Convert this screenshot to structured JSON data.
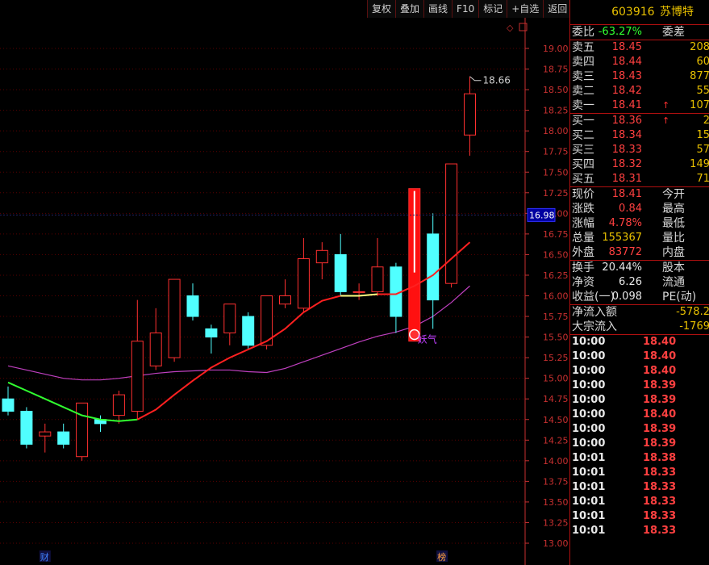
{
  "toolbar": {
    "buttons": [
      "复权",
      "叠加",
      "画线",
      "F10",
      "标记",
      "+自选",
      "返回"
    ]
  },
  "stock": {
    "code": "603916",
    "name": "苏博特"
  },
  "weibi": {
    "label": "委比",
    "value": "-63.27%",
    "label2": "委差"
  },
  "asks": [
    {
      "label": "卖五",
      "price": "18.45",
      "vol": "208",
      "arrow": ""
    },
    {
      "label": "卖四",
      "price": "18.44",
      "vol": "60",
      "arrow": ""
    },
    {
      "label": "卖三",
      "price": "18.43",
      "vol": "877",
      "arrow": ""
    },
    {
      "label": "卖二",
      "price": "18.42",
      "vol": "55",
      "arrow": ""
    },
    {
      "label": "卖一",
      "price": "18.41",
      "vol": "107",
      "arrow": "↑"
    }
  ],
  "bids": [
    {
      "label": "买一",
      "price": "18.36",
      "vol": "2",
      "arrow": "↑"
    },
    {
      "label": "买二",
      "price": "18.34",
      "vol": "15",
      "arrow": ""
    },
    {
      "label": "买三",
      "price": "18.33",
      "vol": "57",
      "arrow": ""
    },
    {
      "label": "买四",
      "price": "18.32",
      "vol": "149",
      "arrow": ""
    },
    {
      "label": "买五",
      "price": "18.31",
      "vol": "71",
      "arrow": ""
    }
  ],
  "stats1": [
    {
      "label": "现价",
      "value": "18.41",
      "color": "red",
      "label2": "今开"
    },
    {
      "label": "涨跌",
      "value": "0.84",
      "color": "red",
      "label2": "最高"
    },
    {
      "label": "涨幅",
      "value": "4.78%",
      "color": "red",
      "label2": "最低"
    },
    {
      "label": "总量",
      "value": "155367",
      "color": "yellow",
      "label2": "量比"
    },
    {
      "label": "外盘",
      "value": "83772",
      "color": "red",
      "label2": "内盘"
    }
  ],
  "stats2": [
    {
      "label": "换手",
      "value": "20.44%",
      "color": "white",
      "label2": "股本"
    },
    {
      "label": "净资",
      "value": "6.26",
      "color": "white",
      "label2": "流通"
    },
    {
      "label": "收益(一)",
      "value": "0.098",
      "color": "white",
      "label2": "PE(动)"
    }
  ],
  "flows": [
    {
      "label": "净流入额",
      "value": "-578.2",
      "color": "green"
    },
    {
      "label": "大宗流入",
      "value": "-1769",
      "color": "green"
    }
  ],
  "ticks": [
    {
      "time": "10:00",
      "price": "18.40"
    },
    {
      "time": "10:00",
      "price": "18.40"
    },
    {
      "time": "10:00",
      "price": "18.40"
    },
    {
      "time": "10:00",
      "price": "18.39"
    },
    {
      "time": "10:00",
      "price": "18.39"
    },
    {
      "time": "10:00",
      "price": "18.40"
    },
    {
      "time": "10:00",
      "price": "18.39"
    },
    {
      "time": "10:00",
      "price": "18.39"
    },
    {
      "time": "10:01",
      "price": "18.38"
    },
    {
      "time": "10:01",
      "price": "18.33"
    },
    {
      "time": "10:01",
      "price": "18.33"
    },
    {
      "time": "10:01",
      "price": "18.33"
    },
    {
      "time": "10:01",
      "price": "18.33"
    },
    {
      "time": "10:01",
      "price": "18.33"
    }
  ],
  "chart_data": {
    "type": "candlestick",
    "y_ticks": [
      "19.00",
      "18.75",
      "18.50",
      "18.25",
      "18.00",
      "17.75",
      "17.50",
      "17.25",
      "17.00",
      "16.75",
      "16.50",
      "16.25",
      "16.00",
      "15.75",
      "15.50",
      "15.25",
      "15.00",
      "14.75",
      "14.50",
      "14.25",
      "14.00",
      "13.75",
      "13.50",
      "13.25",
      "13.00"
    ],
    "ylim": [
      12.85,
      19.15
    ],
    "current_price_tag": "16.98",
    "high_label": "18.66",
    "annotation": "妖气",
    "bottom_markers": [
      "财",
      "榜"
    ],
    "candles": [
      {
        "o": 14.75,
        "c": 14.6,
        "h": 14.9,
        "l": 14.55
      },
      {
        "o": 14.6,
        "c": 14.2,
        "h": 14.65,
        "l": 14.15
      },
      {
        "o": 14.3,
        "c": 14.35,
        "h": 14.45,
        "l": 14.1
      },
      {
        "o": 14.35,
        "c": 14.2,
        "h": 14.45,
        "l": 14.15
      },
      {
        "o": 14.05,
        "c": 14.7,
        "h": 14.7,
        "l": 14.0
      },
      {
        "o": 14.5,
        "c": 14.45,
        "h": 14.55,
        "l": 14.35
      },
      {
        "o": 14.55,
        "c": 14.8,
        "h": 14.85,
        "l": 14.45
      },
      {
        "o": 14.6,
        "c": 15.45,
        "h": 15.95,
        "l": 14.5
      },
      {
        "o": 15.15,
        "c": 15.55,
        "h": 15.85,
        "l": 15.1
      },
      {
        "o": 15.25,
        "c": 16.2,
        "h": 16.2,
        "l": 15.2
      },
      {
        "o": 16.0,
        "c": 15.75,
        "h": 16.15,
        "l": 15.7
      },
      {
        "o": 15.6,
        "c": 15.5,
        "h": 15.65,
        "l": 15.3
      },
      {
        "o": 15.55,
        "c": 15.9,
        "h": 15.9,
        "l": 15.4
      },
      {
        "o": 15.75,
        "c": 15.4,
        "h": 15.8,
        "l": 15.35
      },
      {
        "o": 15.4,
        "c": 16.0,
        "h": 16.0,
        "l": 15.35
      },
      {
        "o": 15.9,
        "c": 16.0,
        "h": 16.2,
        "l": 15.85
      },
      {
        "o": 15.85,
        "c": 16.45,
        "h": 16.7,
        "l": 15.8
      },
      {
        "o": 16.4,
        "c": 16.55,
        "h": 16.65,
        "l": 16.2
      },
      {
        "o": 16.5,
        "c": 16.05,
        "h": 16.75,
        "l": 16.0
      },
      {
        "o": 16.05,
        "c": 16.05,
        "h": 16.15,
        "l": 15.95
      },
      {
        "o": 16.05,
        "c": 16.35,
        "h": 16.7,
        "l": 16.0
      },
      {
        "o": 16.35,
        "c": 15.75,
        "h": 16.4,
        "l": 15.55
      },
      {
        "o": 15.45,
        "c": 17.3,
        "h": 17.3,
        "l": 15.45
      },
      {
        "o": 16.75,
        "c": 15.95,
        "h": 17.0,
        "l": 15.6
      },
      {
        "o": 16.15,
        "c": 17.6,
        "h": 17.6,
        "l": 16.1
      },
      {
        "o": 17.95,
        "c": 18.45,
        "h": 18.66,
        "l": 17.7
      }
    ],
    "ma_short": [
      14.95,
      14.85,
      14.75,
      14.65,
      14.55,
      14.5,
      14.48,
      14.5,
      14.62,
      14.8,
      14.97,
      15.13,
      15.25,
      15.35,
      15.45,
      15.6,
      15.8,
      15.94,
      16.0,
      16.0,
      16.02,
      16.02,
      16.12,
      16.25,
      16.45,
      16.65
    ],
    "ma_short_segments": [
      {
        "from": 0,
        "to": 7,
        "color": "#30ff30"
      },
      {
        "from": 7,
        "to": 18,
        "color": "#ff2020"
      },
      {
        "from": 18,
        "to": 20,
        "color": "#ffff80"
      },
      {
        "from": 20,
        "to": 25,
        "color": "#ff2020"
      }
    ],
    "ma_long": [
      15.15,
      15.1,
      15.05,
      15.0,
      14.98,
      14.98,
      15.0,
      15.03,
      15.06,
      15.08,
      15.09,
      15.1,
      15.1,
      15.08,
      15.07,
      15.12,
      15.2,
      15.28,
      15.36,
      15.44,
      15.51,
      15.56,
      15.63,
      15.75,
      15.92,
      16.12
    ]
  }
}
